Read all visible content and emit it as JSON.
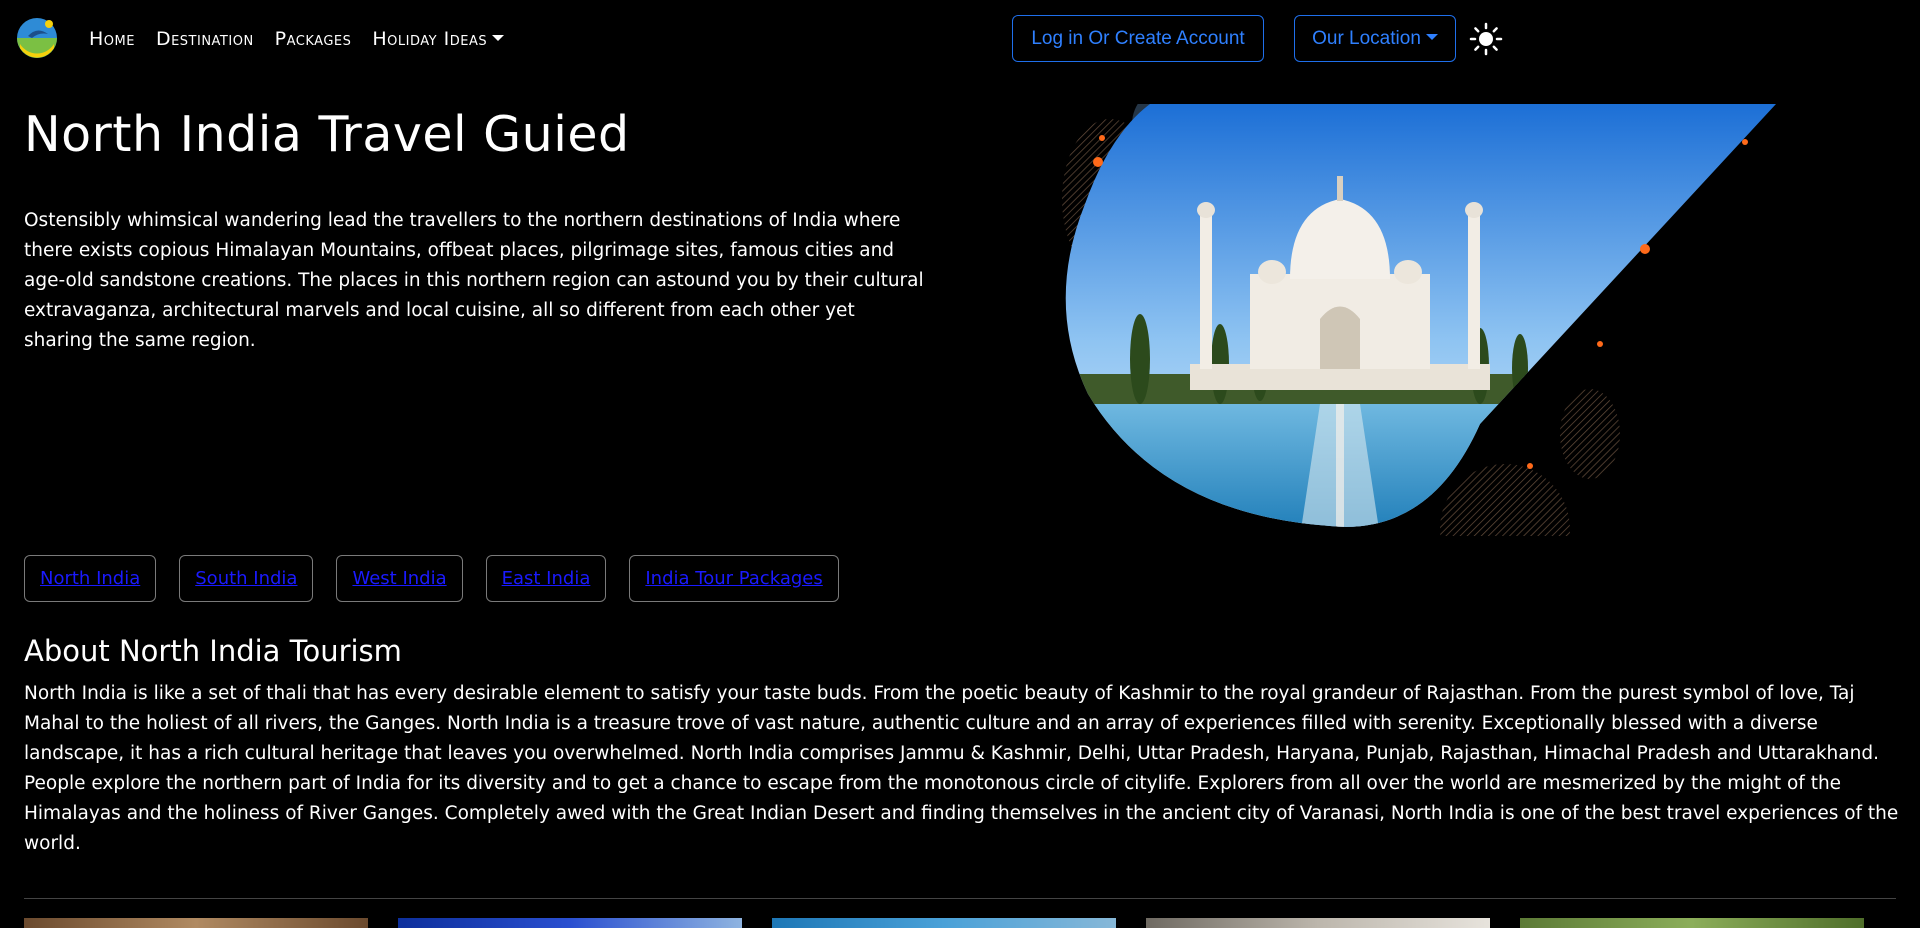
{
  "nav": {
    "links": [
      {
        "label": "Home"
      },
      {
        "label": "Destination"
      },
      {
        "label": "Packages"
      },
      {
        "label": "Holiday Ideas"
      }
    ],
    "login_label": "Log in Or Create Account",
    "location_label": "Our Location",
    "theme_icon": "sun-icon"
  },
  "hero": {
    "title": "North India Travel Guied",
    "text": "Ostensibly whimsical wandering lead the travellers to the northern destinations of India where there exists copious Himalayan Mountains, offbeat places, pilgrimage sites, famous cities and age-old sandstone creations. The places in this northern region can astound you by their cultural extravaganza, architectural marvels and local cuisine, all so different from each other yet sharing the same region."
  },
  "regions": [
    {
      "label": "North India"
    },
    {
      "label": "South India"
    },
    {
      "label": "West India"
    },
    {
      "label": "East India"
    },
    {
      "label": "India Tour Packages"
    }
  ],
  "about": {
    "title": "About North India Tourism",
    "text": "North India is like a set of thali that has every desirable element to satisfy your taste buds. From the poetic beauty of Kashmir to the royal grandeur of Rajasthan. From the purest symbol of love, Taj Mahal to the holiest of all rivers, the Ganges. North India is a treasure trove of vast nature, authentic culture and an array of experiences filled with serenity. Exceptionally blessed with a diverse landscape, it has a rich cultural heritage that leaves you overwhelmed. North India comprises Jammu & Kashmir, Delhi, Uttar Pradesh, Haryana, Punjab, Rajasthan, Himachal Pradesh and Uttarakhand. People explore the northern part of India for its diversity and to get a chance to escape from the monotonous circle of citylife. Explorers from all over the world are mesmerized by the might of the Himalayas and the holiness of River Ganges. Completely awed with the Great Indian Desert and finding themselves in the ancient city of Varanasi, North India is one of the best travel experiences of the world."
  },
  "colors": {
    "background": "#000000",
    "accent": "#1f6feb",
    "region_link": "#1a1aff"
  }
}
